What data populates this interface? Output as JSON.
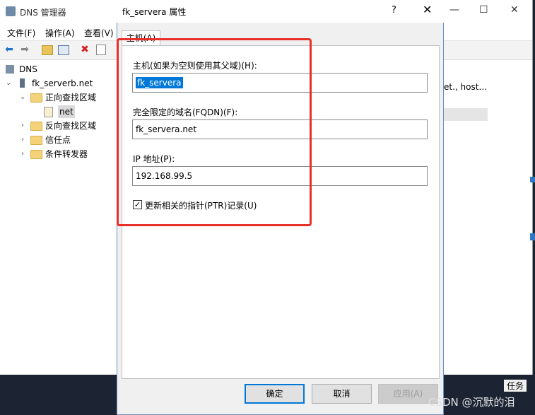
{
  "bg_window": {
    "title": "DNS 管理器",
    "menus": [
      "文件(F)",
      "操作(A)",
      "查看(V)"
    ],
    "tree": {
      "root": "DNS",
      "server": "fk_serverb.net",
      "forward": "正向查找区域",
      "zone": "net",
      "reverse": "反向查找区域",
      "trust": "信任点",
      "conditional": "条件转发器"
    },
    "right_fragment": "et., host…",
    "task_tab": "任务"
  },
  "dialog": {
    "title": "fk_servera 属性",
    "help": "?",
    "tab": "主机(A)",
    "host_label": "主机(如果为空则使用其父域)(H):",
    "host_value": "fk_servera",
    "fqdn_label": "完全限定的域名(FQDN)(F):",
    "fqdn_value": "fk_servera.net",
    "ip_label": "IP 地址(P):",
    "ip_value": "192.168.99.5",
    "ptr_label": "更新相关的指针(PTR)记录(U)",
    "ptr_checked": true,
    "ok": "确定",
    "cancel": "取消",
    "apply": "应用(A)"
  },
  "watermark": "CSDN @沉默的泪",
  "icons": [
    "dns-icon",
    "back-arrow-icon",
    "forward-arrow-icon",
    "folder-up-icon",
    "panel-icon",
    "delete-icon",
    "properties-icon",
    "server-icon",
    "folder-icon",
    "zone-file-icon",
    "checkmark-icon",
    "close-icon",
    "minimize-icon",
    "maximize-icon"
  ],
  "colors": {
    "selection": "#0078d7",
    "highlight_box": "#e8302a",
    "folder": "#f3d27a"
  }
}
